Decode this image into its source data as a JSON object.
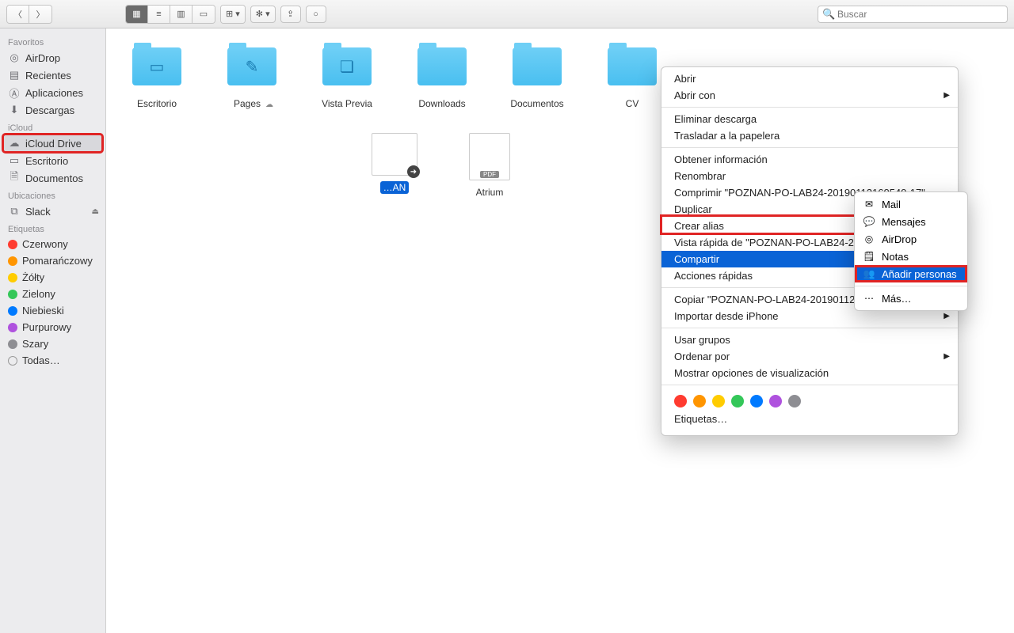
{
  "toolbar": {
    "search_placeholder": "Buscar"
  },
  "sidebar": {
    "favorites_header": "Favoritos",
    "favorites": [
      {
        "label": "AirDrop",
        "icon": "◎"
      },
      {
        "label": "Recientes",
        "icon": "▤"
      },
      {
        "label": "Aplicaciones",
        "icon": "A"
      },
      {
        "label": "Descargas",
        "icon": "⬇"
      }
    ],
    "icloud_header": "iCloud",
    "icloud": [
      {
        "label": "iCloud Drive",
        "icon": "☁"
      },
      {
        "label": "Escritorio",
        "icon": "▭"
      },
      {
        "label": "Documentos",
        "icon": "🗎"
      }
    ],
    "locations_header": "Ubicaciones",
    "locations": [
      {
        "label": "Slack",
        "icon": "⧉"
      }
    ],
    "tags_header": "Etiquetas",
    "tags": [
      {
        "label": "Czerwony",
        "color": "#ff3b30"
      },
      {
        "label": "Pomarańczowy",
        "color": "#ff9500"
      },
      {
        "label": "Żółty",
        "color": "#ffcc00"
      },
      {
        "label": "Zielony",
        "color": "#34c759"
      },
      {
        "label": "Niebieski",
        "color": "#007aff"
      },
      {
        "label": "Purpurowy",
        "color": "#af52de"
      },
      {
        "label": "Szary",
        "color": "#8e8e93"
      }
    ],
    "all_tags": "Todas…"
  },
  "files": [
    {
      "label": "Escritorio",
      "type": "folder",
      "mark": "▭"
    },
    {
      "label": "Pages",
      "type": "folder",
      "mark": "✎",
      "cloud": true
    },
    {
      "label": "Vista Previa",
      "type": "folder",
      "mark": "❏"
    },
    {
      "label": "Downloads",
      "type": "folder"
    },
    {
      "label": "Documentos",
      "type": "folder"
    },
    {
      "label": "CV",
      "type": "folder"
    },
    {
      "label": "…AN",
      "type": "image",
      "selected": true
    },
    {
      "label": "Atrium",
      "type": "pdf"
    }
  ],
  "context_menu": {
    "open": "Abrir",
    "open_with": "Abrir con",
    "remove_download": "Eliminar descarga",
    "trash": "Trasladar a la papelera",
    "get_info": "Obtener información",
    "rename": "Renombrar",
    "compress": "Comprimir \"POZNAN-PO-LAB24-20190112160540-17\"",
    "duplicate": "Duplicar",
    "alias": "Crear alias",
    "quicklook": "Vista rápida de \"POZNAN-PO-LAB24-20190112160540-17\"",
    "share": "Compartir",
    "quick_actions": "Acciones rápidas",
    "copy": "Copiar \"POZNAN-PO-LAB24-20190112160540-17\"",
    "import_iphone": "Importar desde iPhone",
    "use_groups": "Usar grupos",
    "sort_by": "Ordenar por",
    "view_options": "Mostrar opciones de visualización",
    "tags_label": "Etiquetas…",
    "tag_colors": [
      "#ff3b30",
      "#ff9500",
      "#ffcc00",
      "#34c759",
      "#007aff",
      "#af52de",
      "#8e8e93"
    ]
  },
  "submenu": {
    "mail": "Mail",
    "messages": "Mensajes",
    "airdrop": "AirDrop",
    "notes": "Notas",
    "add_people": "Añadir personas",
    "more": "Más…"
  }
}
